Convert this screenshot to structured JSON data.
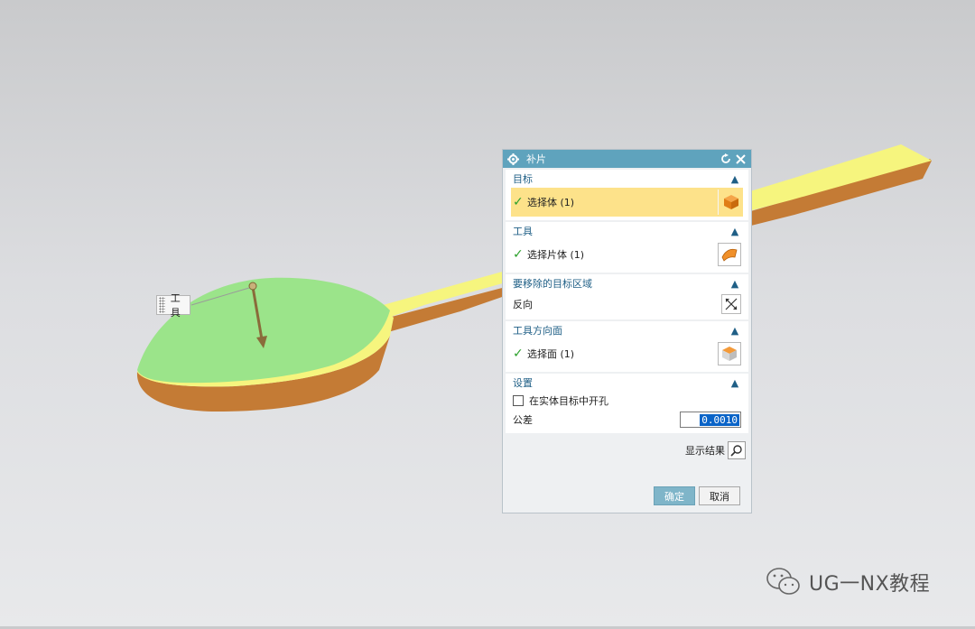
{
  "viewport": {
    "tool_label": "工具",
    "colors": {
      "face_yellow": "#f7f77f",
      "side_brown": "#c97f3a",
      "dome_green": "#9be48a"
    }
  },
  "dialog": {
    "title": "补片",
    "icons": {
      "title_icon": "gear-icon",
      "reset": "reset-icon",
      "close": "close-icon"
    },
    "sections": [
      {
        "label": "目标",
        "row_text": "选择体 (1)",
        "row_icon": "solid-body-icon"
      },
      {
        "label": "工具",
        "row_text": "选择片体 (1)",
        "row_icon": "sheet-body-icon"
      },
      {
        "label": "要移除的目标区域",
        "row_text": "反向",
        "row_icon": "reverse-direction-icon"
      },
      {
        "label": "工具方向面",
        "row_text": "选择面 (1)",
        "row_icon": "face-select-icon"
      },
      {
        "label": "设置"
      }
    ],
    "settings": {
      "hole_checkbox_label": "在实体目标中开孔",
      "hole_checked": false,
      "tolerance_label": "公差",
      "tolerance_value": "0.0010"
    },
    "preview_label": "显示结果",
    "ok_label": "确定",
    "cancel_label": "取消",
    "accent_color": "#5fa3bd",
    "highlight_color": "#fde28a"
  },
  "watermark": {
    "text": "UG一NX教程"
  }
}
